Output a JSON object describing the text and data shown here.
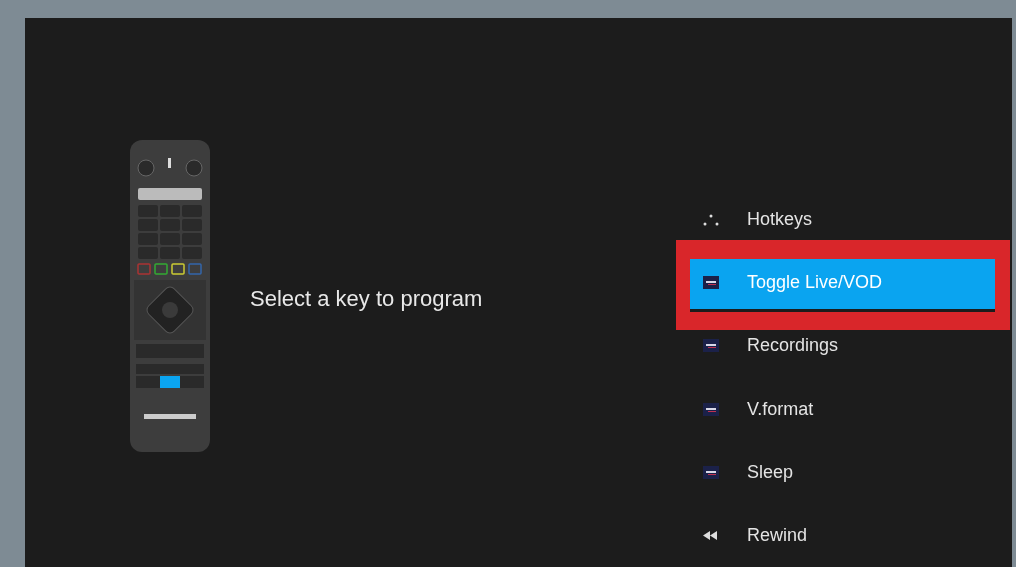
{
  "prompt": "Select a key to program",
  "menu": [
    {
      "kind": "hotkeys",
      "label": "Hotkeys",
      "selected": false,
      "annotated": false
    },
    {
      "kind": "app",
      "label": "Toggle Live/VOD",
      "selected": true,
      "annotated": true
    },
    {
      "kind": "app",
      "label": "Recordings",
      "selected": false,
      "annotated": false
    },
    {
      "kind": "app",
      "label": "V.format",
      "selected": false,
      "annotated": false
    },
    {
      "kind": "app",
      "label": "Sleep",
      "selected": false,
      "annotated": false
    },
    {
      "kind": "rewind",
      "label": "Rewind",
      "selected": false,
      "annotated": false
    }
  ]
}
